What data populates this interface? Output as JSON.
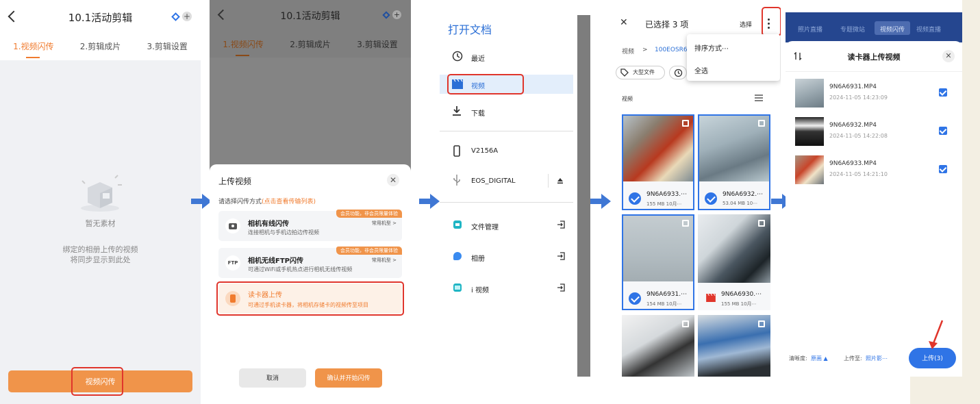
{
  "panel1": {
    "title": "10.1活动剪辑",
    "tabs": [
      "1.视频闪传",
      "2.剪辑成片",
      "3.剪辑设置"
    ],
    "empty_title": "暂无素材",
    "empty_line1": "绑定的相册上传的视频",
    "empty_line2": "将同步显示到此处",
    "bottom_button": "视频闪传"
  },
  "panel2": {
    "title": "10.1活动剪辑",
    "tabs": [
      "1.视频闪传",
      "2.剪辑成片",
      "3.剪辑设置"
    ],
    "sheet_title": "上传视频",
    "prompt": "请选择闪传方式",
    "prompt_link": "(点击查看传输列表)",
    "options": [
      {
        "badge": "会员功能，非会员限量体验",
        "title": "相机有线闪传",
        "desc": "连接相机与手机边拍边传视频",
        "right": "常用机型 >"
      },
      {
        "badge": "会员功能，非会员限量体验",
        "title": "相机无线FTP闪传",
        "desc": "可通过WiFi或手机热点进行相机无线传视频",
        "right": "常用机型 >"
      },
      {
        "title": "读卡器上传",
        "desc": "可通过手机读卡器，将相机存储卡的视频传至项目"
      }
    ],
    "ftp_icon_text": "FTP",
    "cancel": "取消",
    "confirm": "确认并开始闪传"
  },
  "panel3": {
    "title": "打开文档",
    "items": [
      "最近",
      "视频",
      "下载",
      "V2156A",
      "EOS_DIGITAL",
      "文件管理",
      "相册",
      "i 视频"
    ]
  },
  "panel4": {
    "title": "已选择 3 项",
    "select": "选择",
    "breadcrumb_root": "视频",
    "breadcrumb_folder": "100EOSR6",
    "chips": [
      "大型文件"
    ],
    "menu_items": [
      "排序方式⋯",
      "全选"
    ],
    "section": "视频",
    "files": [
      {
        "name": "9N6A6933.⋯",
        "meta": "155 MB 10月⋯"
      },
      {
        "name": "9N6A6932.⋯",
        "meta": "53.04 MB 10⋯"
      },
      {
        "name": "9N6A6931.⋯",
        "meta": "154 MB 10月⋯"
      },
      {
        "name": "9N6A6930.⋯",
        "meta": "155 MB 10月⋯"
      }
    ]
  },
  "panel5": {
    "top_tabs": [
      "照片直播",
      "专题微站",
      "视频闪传",
      "视频直播"
    ],
    "title": "读卡器上传视频",
    "files": [
      {
        "name": "9N6A6931.MP4",
        "date": "2024-11-05 14:23:09"
      },
      {
        "name": "9N6A6932.MP4",
        "date": "2024-11-05 14:22:08"
      },
      {
        "name": "9N6A6933.MP4",
        "date": "2024-11-05 14:21:10"
      }
    ],
    "clarity_label": "清晰度:",
    "clarity_value": "原画",
    "upload_to_label": "上传至:",
    "upload_to_value": "照片影⋯",
    "upload_button": "上传(3)"
  }
}
